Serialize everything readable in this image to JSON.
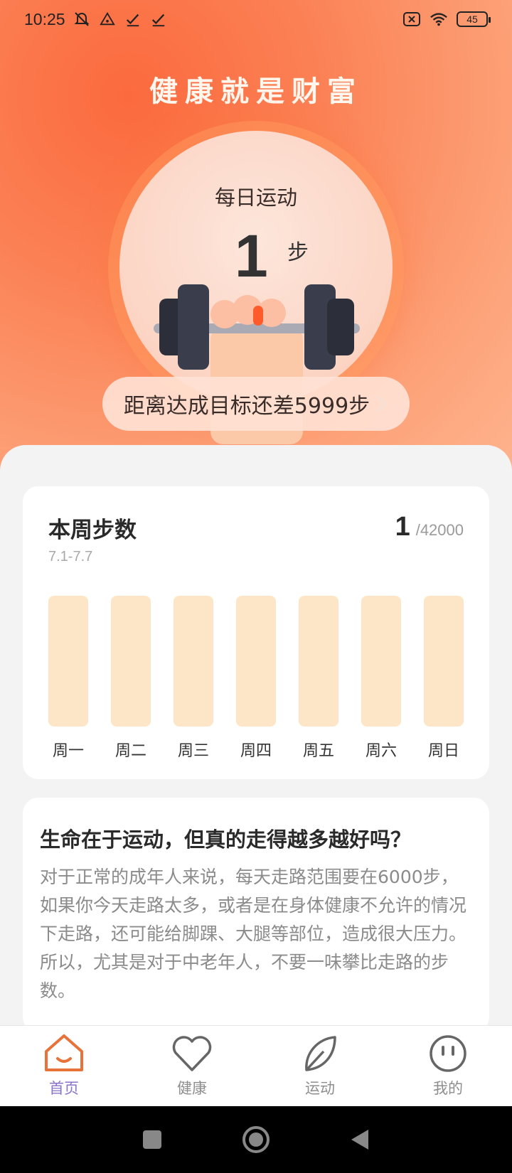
{
  "status_bar": {
    "time": "10:25",
    "battery": "45"
  },
  "hero": {
    "title": "健康就是财富",
    "circle_label": "每日运动",
    "steps": "1",
    "steps_unit": "步",
    "goal_text": "距离达成目标还差5999步"
  },
  "week_card": {
    "title": "本周步数",
    "date_range": "7.1-7.7",
    "total": "1",
    "goal": "/42000",
    "days": [
      {
        "label": "周一",
        "steps": 0
      },
      {
        "label": "周二",
        "steps": 0
      },
      {
        "label": "周三",
        "steps": 0
      },
      {
        "label": "周四",
        "steps": 0
      },
      {
        "label": "周五",
        "steps": 0
      },
      {
        "label": "周六",
        "steps": 0
      },
      {
        "label": "周日",
        "steps": 1
      }
    ],
    "daily_goal": 6000,
    "colors": {
      "track": "#fde6c7",
      "fill": "#fb8a4e"
    }
  },
  "article": {
    "title": "生命在于运动，但真的走得越多越好吗？",
    "body": "对于正常的成年人来说，每天走路范围要在6000步，如果你今天走路太多，或者是在身体健康不允许的情况下走路，还可能给脚踝、大腿等部位，造成很大压力。所以，尤其是对于中老年人，不要一味攀比走路的步数。"
  },
  "tabs": [
    {
      "label": "首页",
      "icon": "home-icon",
      "active": true
    },
    {
      "label": "健康",
      "icon": "heart-icon",
      "active": false
    },
    {
      "label": "运动",
      "icon": "leaf-icon",
      "active": false
    },
    {
      "label": "我的",
      "icon": "smiley-icon",
      "active": false
    }
  ],
  "colors": {
    "accent": "#fb6a3e",
    "active_tab": "#e8733a",
    "active_tab_label": "#8a73c8"
  }
}
